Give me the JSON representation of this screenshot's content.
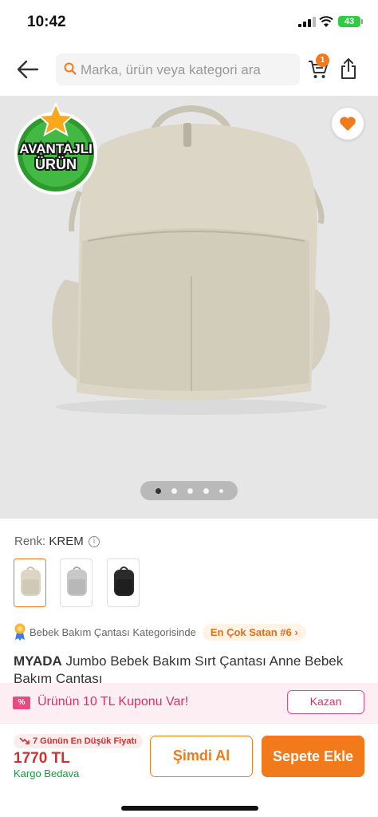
{
  "status": {
    "time": "10:42",
    "battery": "43"
  },
  "header": {
    "search_placeholder": "Marka, ürün veya kategori ara",
    "cart_count": "1"
  },
  "hero": {
    "badge_line1": "AVANTAJLI",
    "badge_line2": "ÜRÜN",
    "carousel_dots": 5,
    "carousel_active": 1
  },
  "color": {
    "label": "Renk:",
    "value": "KREM",
    "swatches": [
      "krem",
      "gri",
      "siyah"
    ],
    "selected": "krem"
  },
  "category": {
    "text": "Bebek Bakım Çantası Kategorisinde",
    "rank": "En Çok Satan #6"
  },
  "product": {
    "brand": "MYADA",
    "name": "Jumbo Bebek Bakım Sırt Çantası Anne Bebek Bakım Çantası"
  },
  "coupon": {
    "icon": "%",
    "text": "Ürünün 10 TL Kuponu Var!",
    "button": "Kazan"
  },
  "footer": {
    "lowest_label": "7 Günün En Düşük Fiyatı",
    "price": "1770 TL",
    "shipping": "Kargo Bedava",
    "buy_now": "Şimdi Al",
    "add_to_cart": "Sepete Ekle"
  },
  "colors": {
    "accent": "#f27a1a",
    "price_red": "#d32f2f",
    "coupon_pink": "#e84a82",
    "green": "#0a9e3a"
  }
}
